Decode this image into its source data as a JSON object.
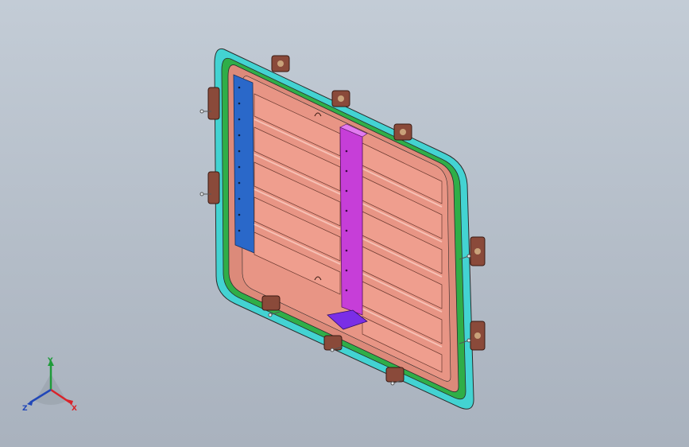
{
  "viewport": {
    "background_top": "#c3ccd6",
    "background_bottom": "#a9b2be"
  },
  "model": {
    "colors": {
      "tray": "#e89585",
      "tray_rib": "#f2b1a2",
      "tray_shadow": "#cf7c6c",
      "flange_cyan": "#43d3d2",
      "seal_green": "#29b64a",
      "left_rail_blue": "#2a68c9",
      "center_beam_magenta": "#c63ed8",
      "beam_foot_purple": "#7a2ee6",
      "mount_bracket": "#8a4a3a",
      "bolt": "#e8ecef",
      "outline": "#2b2b2b"
    }
  },
  "triad": {
    "x_label": "X",
    "y_label": "Y",
    "z_label": "Z",
    "x_color": "#d9232a",
    "y_color": "#1f9b3a",
    "z_color": "#2147b8"
  }
}
